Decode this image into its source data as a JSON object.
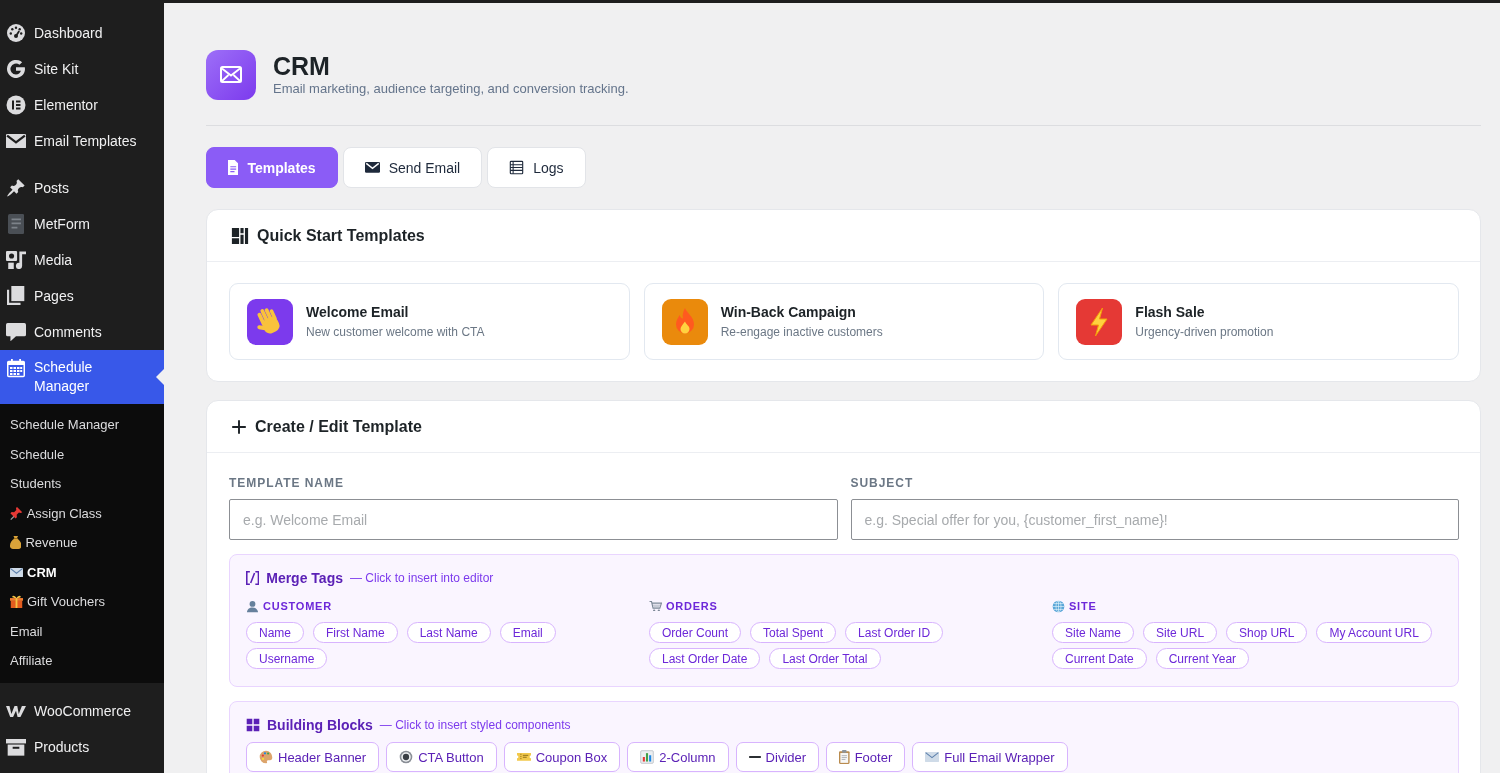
{
  "sidebar": {
    "sections": [
      {
        "items": [
          {
            "label": "Dashboard",
            "selected": false
          },
          {
            "label": "Site Kit",
            "selected": false
          },
          {
            "label": "Elementor",
            "selected": false
          },
          {
            "label": "Email Templates",
            "selected": false
          }
        ]
      },
      {
        "items": [
          {
            "label": "Posts",
            "selected": false
          },
          {
            "label": "MetForm",
            "selected": false
          },
          {
            "label": "Media",
            "selected": false
          },
          {
            "label": "Pages",
            "selected": false
          },
          {
            "label": "Comments",
            "selected": false
          },
          {
            "label": "Schedule Manager",
            "selected": true,
            "submenu": [
              {
                "label": "Schedule Manager",
                "selected": false
              },
              {
                "label": "Schedule",
                "selected": false
              },
              {
                "label": "Students",
                "selected": false
              },
              {
                "label": "Assign Class",
                "selected": false
              },
              {
                "label": "Revenue",
                "selected": false
              },
              {
                "label": "CRM",
                "selected": true
              },
              {
                "label": "Gift Vouchers",
                "selected": false
              },
              {
                "label": "Email",
                "selected": false
              },
              {
                "label": "Affiliate",
                "selected": false
              }
            ]
          }
        ]
      },
      {
        "items": [
          {
            "label": "WooCommerce",
            "selected": false
          },
          {
            "label": "Products",
            "selected": false
          }
        ]
      }
    ]
  },
  "header": {
    "title": "CRM",
    "subtitle": "Email marketing, audience targeting, and conversion tracking."
  },
  "tabs": [
    {
      "label": "Templates",
      "selected": true
    },
    {
      "label": "Send Email",
      "selected": false
    },
    {
      "label": "Logs",
      "selected": false
    }
  ],
  "quick_start": {
    "title": "Quick Start Templates",
    "templates": [
      {
        "title": "Welcome Email",
        "description": "New customer welcome with CTA",
        "color": "#7c3aed"
      },
      {
        "title": "Win-Back Campaign",
        "description": "Re-engage inactive customers",
        "color": "#ea8a0c"
      },
      {
        "title": "Flash Sale",
        "description": "Urgency-driven promotion",
        "color": "#e53935"
      }
    ]
  },
  "editor": {
    "title": "Create / Edit Template",
    "fields": [
      {
        "label": "TEMPLATE NAME",
        "placeholder": "e.g. Welcome Email"
      },
      {
        "label": "SUBJECT",
        "placeholder": "e.g. Special offer for you, {customer_first_name}!"
      }
    ],
    "merge_tags": {
      "title": "Merge Tags",
      "hint": "— Click to insert into editor",
      "groups": [
        {
          "label": "CUSTOMER",
          "tags": [
            "Name",
            "First Name",
            "Last Name",
            "Email",
            "Username"
          ]
        },
        {
          "label": "ORDERS",
          "tags": [
            "Order Count",
            "Total Spent",
            "Last Order ID",
            "Last Order Date",
            "Last Order Total"
          ]
        },
        {
          "label": "SITE",
          "tags": [
            "Site Name",
            "Site URL",
            "Shop URL",
            "My Account URL",
            "Current Date",
            "Current Year"
          ]
        }
      ]
    },
    "building_blocks": {
      "title": "Building Blocks",
      "hint": "— Click to insert styled components",
      "blocks": [
        "Header Banner",
        "CTA Button",
        "Coupon Box",
        "2-Column",
        "Divider",
        "Footer",
        "Full Email Wrapper"
      ]
    }
  }
}
